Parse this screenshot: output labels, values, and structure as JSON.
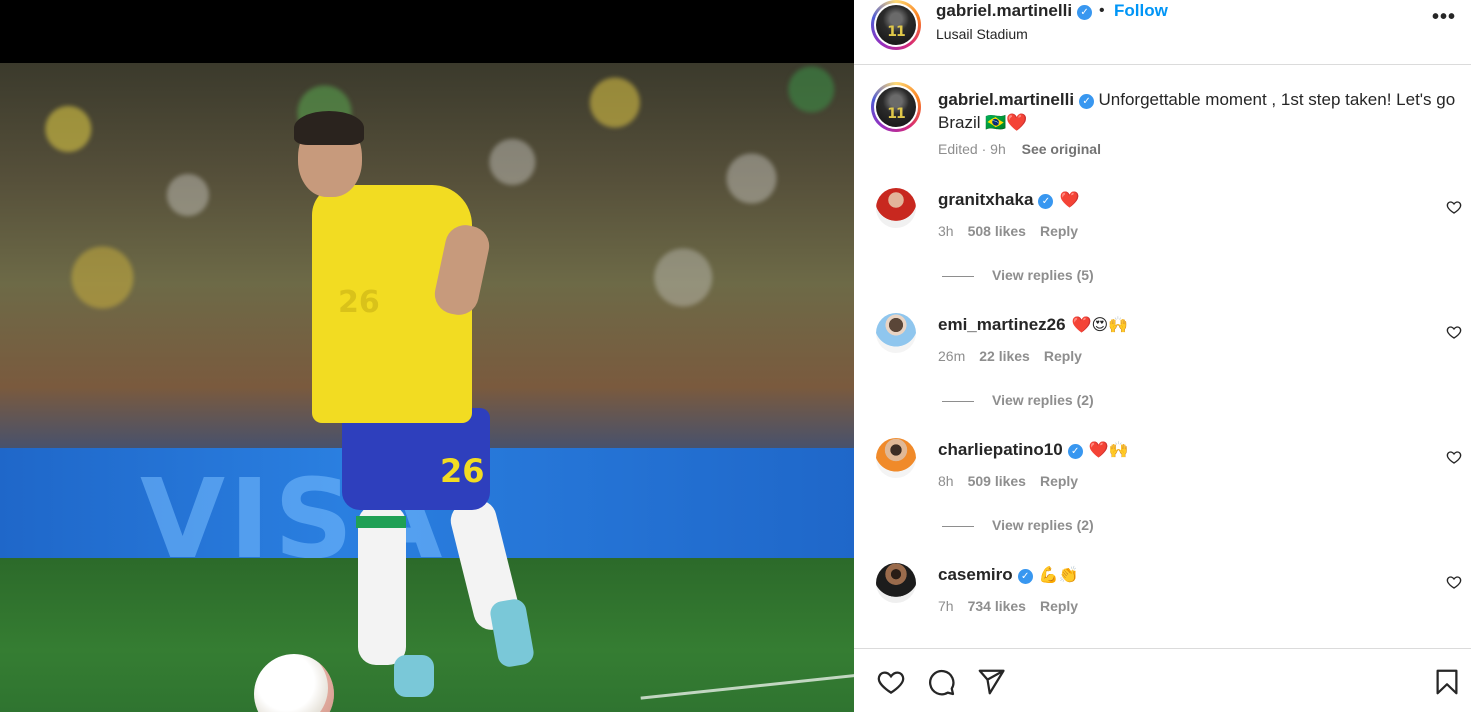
{
  "post": {
    "username": "gabriel.martinelli",
    "follow_label": "Follow",
    "separator": "•",
    "location": "Lusail Stadium",
    "more_icon": "more-horizontal-icon",
    "avatar_text": "11"
  },
  "media": {
    "banner_text": "VISA",
    "jersey_number_shorts": "26",
    "jersey_number_shirt": "26"
  },
  "caption": {
    "username": "gabriel.martinelli",
    "text": "Unforgettable moment , 1st step taken! Let's go Brazil 🇧🇷❤️",
    "edited_label": "Edited",
    "dot": "·",
    "time": "9h",
    "see_original": "See original"
  },
  "comments": [
    {
      "username": "granitxhaka",
      "text": "❤️",
      "time": "3h",
      "likes": "508 likes",
      "reply": "Reply",
      "view_replies": "View replies (5)"
    },
    {
      "username": "emi_martinez26",
      "text": "❤️😍🙌",
      "time": "26m",
      "likes": "22 likes",
      "reply": "Reply",
      "view_replies": "View replies (2)"
    },
    {
      "username": "charliepatino10",
      "text": "❤️🙌",
      "time": "8h",
      "likes": "509 likes",
      "reply": "Reply",
      "view_replies": "View replies (2)"
    },
    {
      "username": "casemiro",
      "text": "💪👏",
      "time": "7h",
      "likes": "734 likes",
      "reply": "Reply"
    }
  ],
  "actions": {
    "like_icon": "heart-icon",
    "comment_icon": "comment-icon",
    "share_icon": "send-icon",
    "save_icon": "bookmark-icon"
  },
  "colors": {
    "accent": "#0095f6",
    "verified": "#3897f0",
    "muted": "#8e8e8e"
  }
}
